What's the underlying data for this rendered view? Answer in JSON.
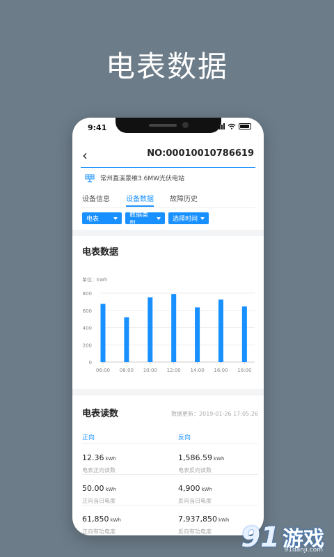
{
  "hero": {
    "title": "电表数据"
  },
  "status_bar": {
    "time": "9:41"
  },
  "nav": {
    "back_icon": "chevron-left-icon",
    "title": "NO:00010010786619"
  },
  "station": {
    "icon": "solar-panel-icon",
    "name": "常州直溪景维3.6MW光伏电站"
  },
  "tabs": [
    {
      "label": "设备信息",
      "active": false
    },
    {
      "label": "设备数据",
      "active": true
    },
    {
      "label": "故障历史",
      "active": false
    }
  ],
  "filters": [
    {
      "label": "电表"
    },
    {
      "label": "数据类型"
    },
    {
      "label": "选择时间"
    }
  ],
  "chart_section": {
    "title": "电表数据",
    "unit": "单位：kWh"
  },
  "chart_data": {
    "type": "bar",
    "categories": [
      "06:00",
      "08:00",
      "10:00",
      "12:00",
      "14:00",
      "16:00",
      "18:00"
    ],
    "values": [
      675,
      520,
      750,
      790,
      635,
      725,
      645
    ],
    "ylim": [
      0,
      800
    ],
    "yticks": [
      "0",
      "200",
      "400",
      "600",
      "800"
    ],
    "title": "",
    "xlabel": "",
    "ylabel": "",
    "grid": true,
    "bar_color": "#1890ff"
  },
  "readings": {
    "title": "电表读数",
    "update": "数据更新：2019-01-26 17:05:26",
    "columns": [
      "正向",
      "反向"
    ],
    "rows": [
      [
        {
          "value": "12.36",
          "unit": "kWh",
          "label": "电表正向读数"
        },
        {
          "value": "1,586.59",
          "unit": "kWh",
          "label": "电表反向读数"
        }
      ],
      [
        {
          "value": "50.00",
          "unit": "kWh",
          "label": "正向当日电度"
        },
        {
          "value": "4,900",
          "unit": "kWh",
          "label": "反向当日电度"
        }
      ],
      [
        {
          "value": "61,850",
          "unit": "kWh",
          "label": "正向有功电度"
        },
        {
          "value": "7,937,850",
          "unit": "kWh",
          "label": "反向有功电度"
        }
      ]
    ]
  },
  "watermark": {
    "logo": "91",
    "text": "游戏",
    "url": "91danji.com"
  },
  "colors": {
    "accent": "#1890ff",
    "background": "#6c7c89"
  }
}
